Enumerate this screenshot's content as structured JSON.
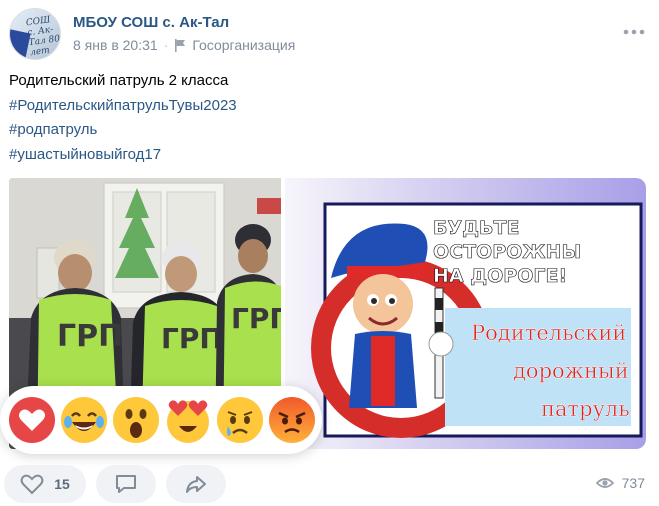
{
  "post": {
    "author": "МБОУ СОШ с. Ак-Тал",
    "date": "8 янв в 20:31",
    "separator": "·",
    "category": "Госорганизация",
    "avatar_text": "СОШ с. Ак-Тал 80 лет",
    "lines": [
      "Родительский патруль 2 класса",
      "#РодительскийпатрульТувы2023",
      "#родпатруль",
      "#ушастыйновыйгод17"
    ]
  },
  "photo_right": {
    "heading_line1": "БУДЬТЕ",
    "heading_line2": "ОСТОРОЖНЫ",
    "heading_line3": "НА ДОРОГЕ!",
    "caption_line1": "Родительский",
    "caption_line2": "дорожный",
    "caption_line3": "патруль"
  },
  "photo_left": {
    "vest_text": "ГРП"
  },
  "reactions": [
    "heart",
    "laughing-crying",
    "astonished",
    "heart-eyes",
    "crying",
    "angry"
  ],
  "actions": {
    "likes": "15",
    "views": "737"
  },
  "colors": {
    "link": "#2a5885",
    "muted": "#818c99",
    "button_bg": "#f0f2f5",
    "heart_red": "#e64646",
    "vest_green": "#a9e04d"
  }
}
